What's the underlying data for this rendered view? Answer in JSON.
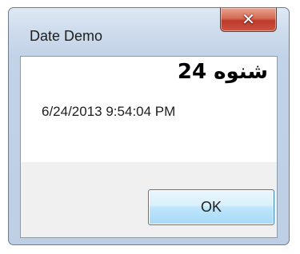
{
  "window": {
    "title": "Date Demo",
    "close_icon": "close-icon",
    "close_glyph": "✕"
  },
  "content": {
    "arabic_label": "شنوه 24",
    "datetime_text": "6/24/2013 9:54:04 PM"
  },
  "buttons": {
    "ok_label": "OK"
  },
  "colors": {
    "close_button": "#c8553f",
    "ok_button_border": "#3c7fb1",
    "titlebar": "#cddbec"
  }
}
